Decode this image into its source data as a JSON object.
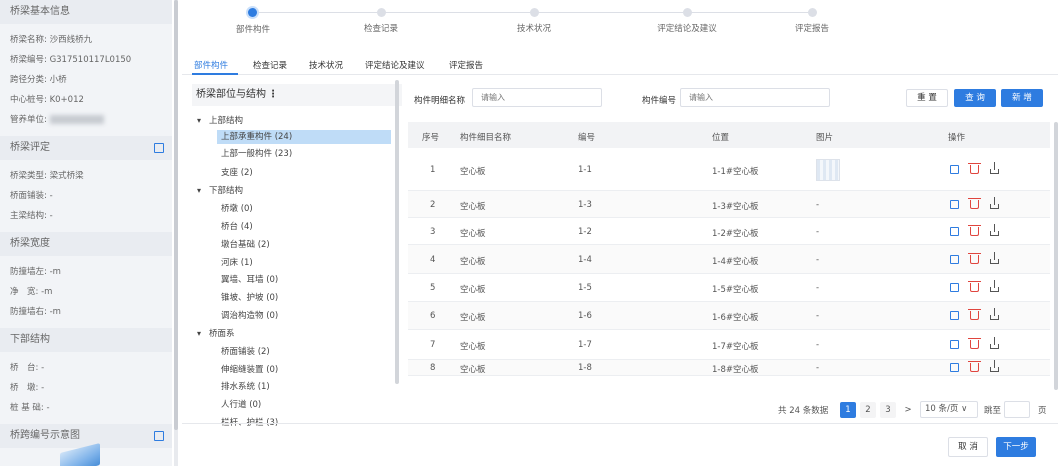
{
  "sidebar": {
    "basic": {
      "title": "桥梁基本信息",
      "fields": [
        "桥梁名称: 沙西线桥九",
        "桥梁编号: G317510117L0150",
        "跨径分类: 小桥",
        "中心桩号: K0+012"
      ],
      "unit_label": "管养单位: "
    },
    "rating": {
      "title": "桥梁评定",
      "fields": [
        "桥梁类型: 梁式桥梁",
        "桥面铺装: -",
        "主梁结构: -"
      ]
    },
    "width": {
      "title": "桥梁宽度",
      "fields": [
        "防撞墙左: -m",
        "净　宽: -m",
        "防撞墙右: -m"
      ]
    },
    "substructure": {
      "title": "下部结构",
      "fields": [
        "桥　台: -",
        "桥　墩: -",
        "桩 基 础: -"
      ]
    },
    "span_diagram": {
      "title": "桥跨编号示意图"
    }
  },
  "steps": [
    {
      "label": "部件构件",
      "active": true
    },
    {
      "label": "检查记录",
      "active": false
    },
    {
      "label": "技术状况",
      "active": false
    },
    {
      "label": "评定结论及建议",
      "active": false
    },
    {
      "label": "评定报告",
      "active": false
    }
  ],
  "tabs": [
    "部件构件",
    "检查记录",
    "技术状况",
    "评定结论及建议",
    "评定报告"
  ],
  "tree": {
    "title": "桥梁部位与结构",
    "kebab": "⋮",
    "nodes": [
      {
        "label": "上部结构",
        "level": 0
      },
      {
        "label": "上部承重构件 (24)",
        "level": 1,
        "selected": true
      },
      {
        "label": "上部一般构件 (23)",
        "level": 1
      },
      {
        "label": "支座 (2)",
        "level": 1
      },
      {
        "label": "下部结构",
        "level": 0
      },
      {
        "label": "桥墩 (0)",
        "level": 1
      },
      {
        "label": "桥台 (4)",
        "level": 1
      },
      {
        "label": "墩台基础 (2)",
        "level": 1
      },
      {
        "label": "河床 (1)",
        "level": 1
      },
      {
        "label": "翼墙、耳墙 (0)",
        "level": 1
      },
      {
        "label": "锥坡、护坡 (0)",
        "level": 1
      },
      {
        "label": "调治构造物 (0)",
        "level": 1
      },
      {
        "label": "桥面系",
        "level": 0
      },
      {
        "label": "桥面铺装 (2)",
        "level": 1
      },
      {
        "label": "伸缩缝装置 (0)",
        "level": 1
      },
      {
        "label": "排水系统 (1)",
        "level": 1
      },
      {
        "label": "人行道 (0)",
        "level": 1
      },
      {
        "label": "栏杆、护栏 (3)",
        "level": 1
      }
    ]
  },
  "filters": {
    "detail_name_label": "构件明细名称",
    "detail_name_placeholder": "请输入",
    "code_label": "构件编号",
    "code_placeholder": "请输入"
  },
  "buttons": {
    "reset": "重 置",
    "query": "查 询",
    "add": "新 增",
    "cancel": "取 消",
    "next": "下一步"
  },
  "table": {
    "headers": [
      "序号",
      "构件细目名称",
      "编号",
      "位置",
      "图片",
      "操作"
    ],
    "rows": [
      {
        "no": "1",
        "name": "空心板",
        "code": "1-1",
        "position": "1-1#空心板",
        "image": ""
      },
      {
        "no": "2",
        "name": "空心板",
        "code": "1-3",
        "position": "1-3#空心板",
        "image": "-"
      },
      {
        "no": "3",
        "name": "空心板",
        "code": "1-2",
        "position": "1-2#空心板",
        "image": "-"
      },
      {
        "no": "4",
        "name": "空心板",
        "code": "1-4",
        "position": "1-4#空心板",
        "image": "-"
      },
      {
        "no": "5",
        "name": "空心板",
        "code": "1-5",
        "position": "1-5#空心板",
        "image": "-"
      },
      {
        "no": "6",
        "name": "空心板",
        "code": "1-6",
        "position": "1-6#空心板",
        "image": "-"
      },
      {
        "no": "7",
        "name": "空心板",
        "code": "1-7",
        "position": "1-7#空心板",
        "image": "-"
      },
      {
        "no": "8",
        "name": "空心板",
        "code": "1-8",
        "position": "1-8#空心板",
        "image": "-"
      }
    ]
  },
  "pagination": {
    "total": "共 24 条数据",
    "pages": [
      "1",
      "2",
      "3"
    ],
    "current": "1",
    "next_arrow": ">",
    "page_size": "10 条/页 ∨",
    "jump_label": "跳至",
    "jump_value": "",
    "page_unit": "页"
  },
  "colors": {
    "primary": "#2e7ce0",
    "danger": "#e0453e",
    "selected_bg": "#bfdcf7"
  }
}
